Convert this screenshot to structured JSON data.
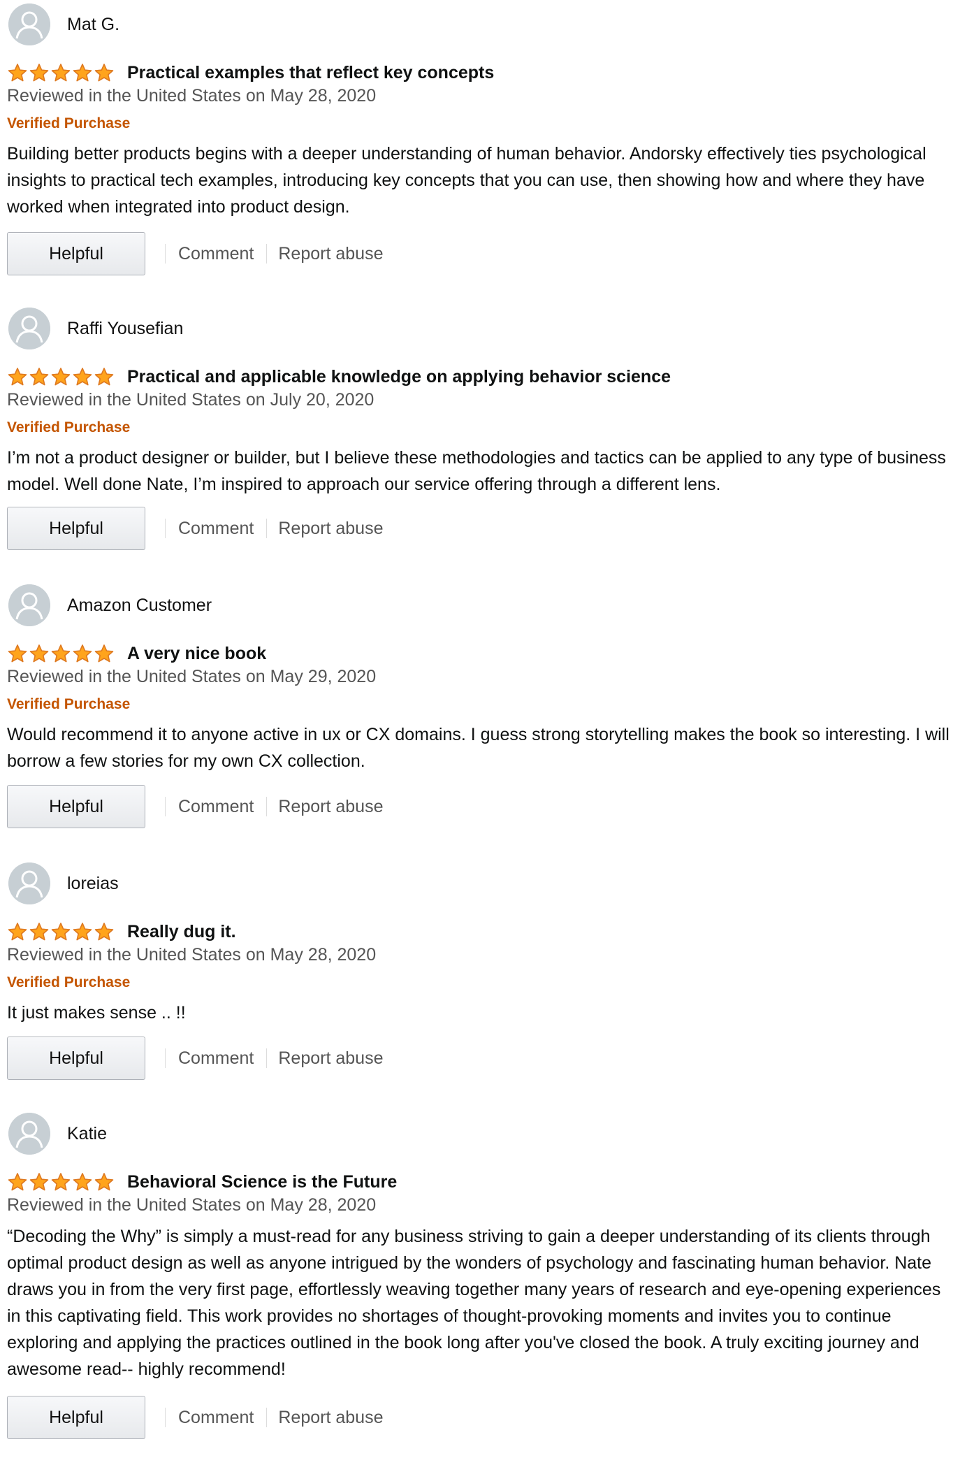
{
  "colors": {
    "star": "#ffa41c",
    "star_outline": "#de7921",
    "verified": "#c45500",
    "meta_text": "#555555",
    "avatar_bg": "#c7cfd4"
  },
  "actions": {
    "helpful": "Helpful",
    "comment": "Comment",
    "report": "Report abuse"
  },
  "reviews": [
    {
      "reviewer": "Mat G.",
      "rating": 5,
      "title": "Practical examples that reflect key concepts",
      "date": "Reviewed in the United States on May 28, 2020",
      "verified": "Verified Purchase",
      "body": "Building better products begins with a deeper understanding of human behavior. Andorsky effectively ties psychological insights to practical tech examples, introducing key concepts that you can use, then showing how and where they have worked when integrated into product design."
    },
    {
      "reviewer": "Raffi Yousefian",
      "rating": 5,
      "title": "Practical and applicable knowledge on applying behavior science",
      "date": "Reviewed in the United States on July 20, 2020",
      "verified": "Verified Purchase",
      "body": "I’m not a product designer or builder, but I believe these methodologies and tactics can be applied to any type of business model. Well done Nate, I’m inspired to approach our service offering through a different lens."
    },
    {
      "reviewer": "Amazon Customer",
      "rating": 5,
      "title": "A very nice book",
      "date": "Reviewed in the United States on May 29, 2020",
      "verified": "Verified Purchase",
      "body": "Would recommend it to anyone active in ux or CX domains. I guess strong storytelling makes the book so interesting. I will borrow a few stories for my own CX collection."
    },
    {
      "reviewer": "loreias",
      "rating": 5,
      "title": "Really dug it.",
      "date": "Reviewed in the United States on May 28, 2020",
      "verified": "Verified Purchase",
      "body": "It just makes sense .. !!"
    },
    {
      "reviewer": "Katie",
      "rating": 5,
      "title": "Behavioral Science is the Future",
      "date": "Reviewed in the United States on May 28, 2020",
      "body": "“Decoding the Why” is simply a must-read for any business striving to gain a deeper understanding of its clients through optimal product design as well as anyone intrigued by the wonders of psychology and fascinating human behavior. Nate draws you in from the very first page, effortlessly weaving together many years of research and eye-opening experiences in this captivating field. This work provides no shortages of thought-provoking moments and invites you to continue exploring and applying the practices outlined in the book long after you've closed the book. A truly exciting journey and awesome read-- highly recommend!"
    }
  ]
}
